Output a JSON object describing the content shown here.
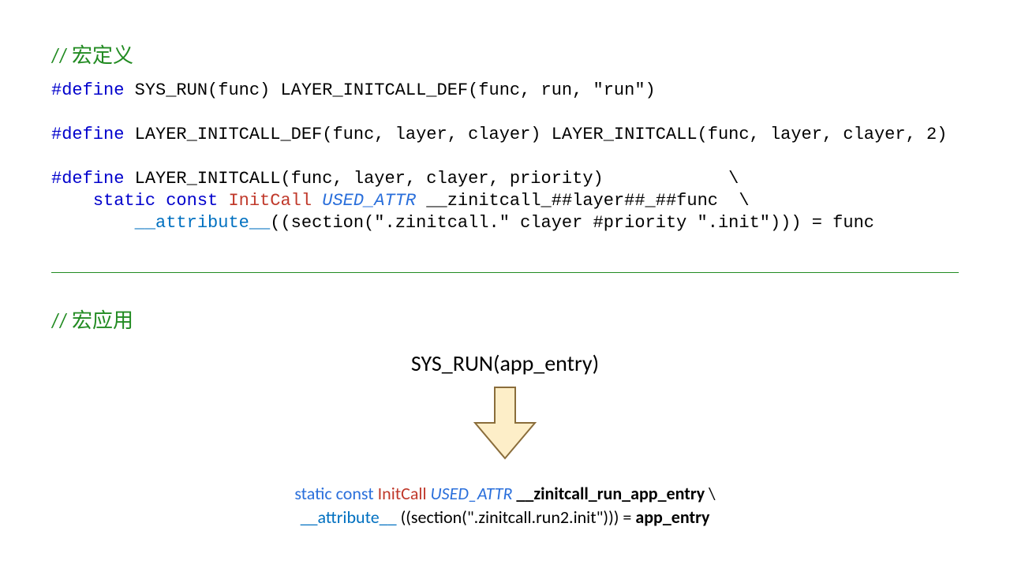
{
  "headings": {
    "definition": "// 宏定义",
    "application": "// 宏应用"
  },
  "code": {
    "line1_define": "#define",
    "line1_rest": " SYS_RUN(func) LAYER_INITCALL_DEF(func, run, \"run\")",
    "line2_define": "#define",
    "line2_rest": " LAYER_INITCALL_DEF(func, layer, clayer) LAYER_INITCALL(func, layer, clayer, 2)",
    "line3_define": "#define",
    "line3_rest": " LAYER_INITCALL(func, layer, clayer, priority)            \\",
    "line4_indent": "    ",
    "line4_static": "static",
    "line4_const": " const",
    "line4_type": " InitCall",
    "line4_attr": " USED_ATTR",
    "line4_rest": " __zinitcall_##layer##_##func  \\",
    "line5_indent": "        ",
    "line5_attr": "__attribute__",
    "line5_rest": "((section(\".zinitcall.\" clayer #priority \".init\"))) = func"
  },
  "expansion": {
    "source": "SYS_RUN(app_entry)",
    "line1_static": "static",
    "line1_const": " const ",
    "line1_type": "InitCall",
    "line1_space": " ",
    "line1_used": "USED_ATTR",
    "line1_sym": " __zinitcall_run_app_entry",
    "line1_cont": " \\",
    "line2_attr": "__attribute__",
    "line2_rest": " ((section(\".zinitcall.run2.init\"))) = ",
    "line2_val": "app_entry"
  }
}
